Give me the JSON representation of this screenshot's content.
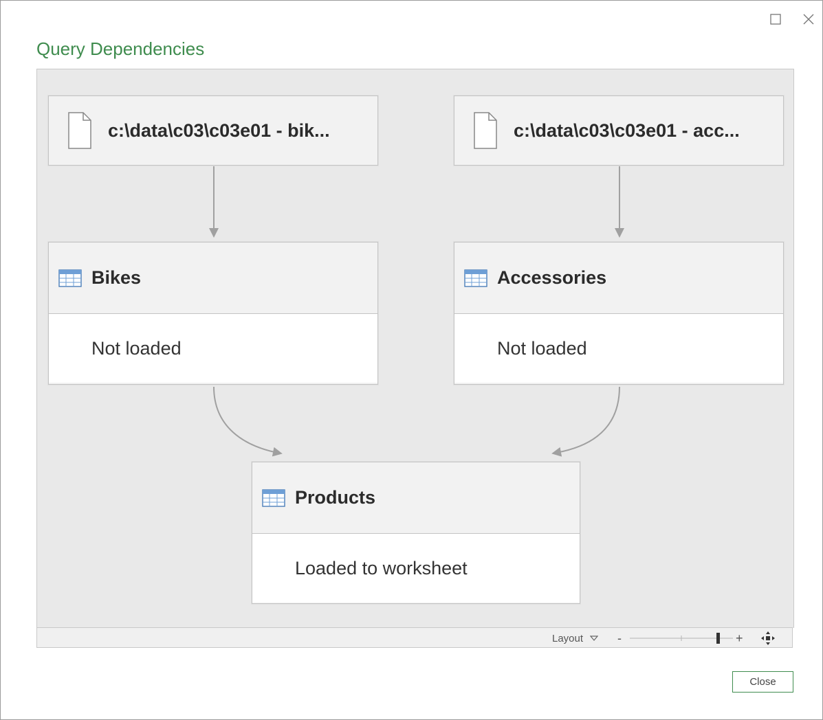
{
  "window": {
    "title": "Query Dependencies",
    "maximize_icon": "maximize-icon",
    "close_icon": "close-icon"
  },
  "nodes": {
    "source_bikes": {
      "label": "c:\\data\\c03\\c03e01 - bik...",
      "icon": "file-icon"
    },
    "source_accessories": {
      "label": "c:\\data\\c03\\c03e01 - acc...",
      "icon": "file-icon"
    },
    "bikes": {
      "title": "Bikes",
      "status": "Not loaded",
      "icon": "table-icon"
    },
    "accessories": {
      "title": "Accessories",
      "status": "Not loaded",
      "icon": "table-icon"
    },
    "products": {
      "title": "Products",
      "status": "Loaded to worksheet",
      "icon": "table-icon"
    }
  },
  "statusbar": {
    "layout_label": "Layout",
    "zoom_out": "-",
    "zoom_in": "+",
    "zoom_level": 0.85
  },
  "buttons": {
    "close_label": "Close"
  },
  "colors": {
    "accent": "#3f8c4e",
    "canvas": "#e9e9e9",
    "edge": "#a0a0a0"
  }
}
